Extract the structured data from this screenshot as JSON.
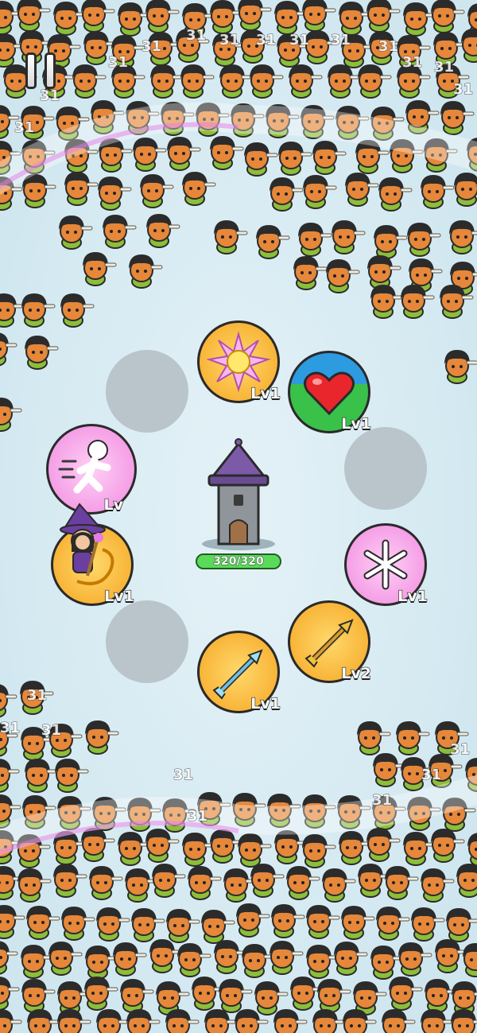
{
  "hud": {
    "pause_icon": "pause-icon"
  },
  "tower": {
    "hp_current": 320,
    "hp_max": 320,
    "hp_text": "320/320"
  },
  "skills": [
    {
      "icon": "sun-burst-icon",
      "level": "Lv1",
      "bg": "#f5a623",
      "accent": "#f8e36b"
    },
    {
      "icon": "heart-icon",
      "level": "Lv1",
      "bg": "#39c14a",
      "accent": "#2d9be0"
    },
    {
      "icon": "running-figure-icon",
      "level": "Lv",
      "bg": "#f08ae0",
      "accent": "#ffffff"
    },
    {
      "icon": "fire-swirl-icon",
      "level": "Lv1",
      "bg": "#f5a623",
      "accent": "#ffd54a"
    },
    {
      "icon": "snowflake-icon",
      "level": "Lv1",
      "bg": "#f08ae0",
      "accent": "#ffffff"
    },
    {
      "icon": "arrow-gold-icon",
      "level": "Lv2",
      "bg": "#f5a623",
      "accent": "#ffd54a"
    },
    {
      "icon": "arrow-blue-icon",
      "level": "Lv1",
      "bg": "#f5a623",
      "accent": "#ffd54a"
    }
  ],
  "damage_numbers": [
    "31",
    "31",
    "31",
    "31",
    "31",
    "31",
    "31",
    "31",
    "31",
    "31",
    "31",
    "31",
    "31",
    "31",
    "31",
    "31",
    "31",
    "31",
    "31",
    "31",
    "31"
  ],
  "colors": {
    "ice": "#d9ecf3",
    "empty_slot": "#b9c4cb",
    "enemy_skin": "#e6873a",
    "enemy_hair": "#2b2b2b",
    "skirt": "#8dbd3a",
    "magic": "#e77be8"
  }
}
